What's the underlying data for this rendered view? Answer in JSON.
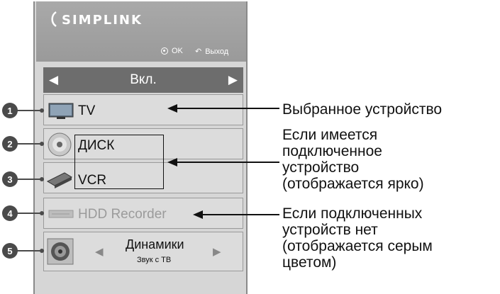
{
  "header": {
    "logo_text": "SIMPLINK",
    "ok_label": "OK",
    "exit_label": "Выход"
  },
  "selector": {
    "label": "Вкл.",
    "left_arrow": "◀",
    "right_arrow": "▶"
  },
  "items": [
    {
      "number": "1",
      "label": "TV",
      "icon": "tv-icon",
      "state": "selected"
    },
    {
      "number": "2",
      "label": "ДИСК",
      "icon": "disc-icon",
      "state": "connected"
    },
    {
      "number": "3",
      "label": "VCR",
      "icon": "vcr-icon",
      "state": "connected"
    },
    {
      "number": "4",
      "label": "HDD Recorder",
      "icon": "hdd-icon",
      "state": "not-connected"
    },
    {
      "number": "5",
      "label": "Динамики",
      "sublabel": "Звук с ТВ",
      "icon": "speaker-icon",
      "left_arrow": "◀",
      "right_arrow": "▶"
    }
  ],
  "annotations": {
    "selected": "Выбранное устройство",
    "connected_1": "Если имеется",
    "connected_2": "подключенное",
    "connected_3": "устройство",
    "connected_4": "(отображается ярко)",
    "none_1": "Если подключенных",
    "none_2": "устройств нет",
    "none_3": "(отображается серым",
    "none_4": "цветом)"
  },
  "colors": {
    "panel_bg": "#d6d6d6",
    "header_bg": "#a0a0a0",
    "selector_bg": "#6d6d6d",
    "badge_bg": "#4a4a4a",
    "dim_text": "#9b9b9b"
  }
}
